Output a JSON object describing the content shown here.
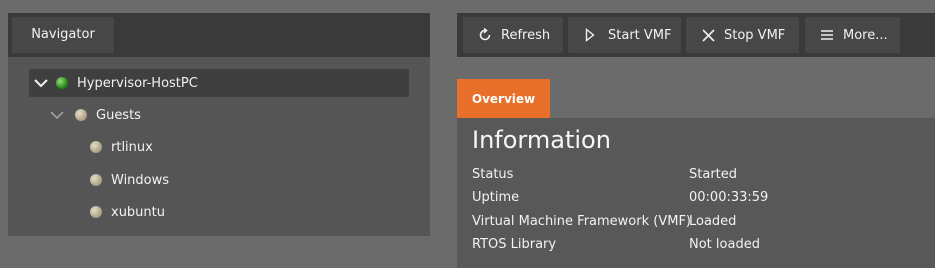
{
  "navigator": {
    "title": "Navigator",
    "tree": {
      "root": "Hypervisor-HostPC",
      "group": "Guests",
      "guests": [
        "rtlinux",
        "Windows",
        "xubuntu"
      ]
    }
  },
  "toolbar": {
    "refresh_label": "Refresh",
    "start_label": "Start VMF",
    "stop_label": "Stop VMF",
    "more_label": "More..."
  },
  "tabs": {
    "overview": "Overview"
  },
  "info": {
    "title": "Information",
    "rows": [
      {
        "key": "Status",
        "value": "Started"
      },
      {
        "key": "Uptime",
        "value": "00:00:33:59"
      },
      {
        "key": "Virtual Machine Framework (VMF)",
        "value": "Loaded"
      },
      {
        "key": "RTOS Library",
        "value": "Not loaded"
      }
    ]
  },
  "colors": {
    "accent_tab": "#e8702a",
    "status_running": "#2f9a1f",
    "status_idle": "#bfb49c"
  }
}
